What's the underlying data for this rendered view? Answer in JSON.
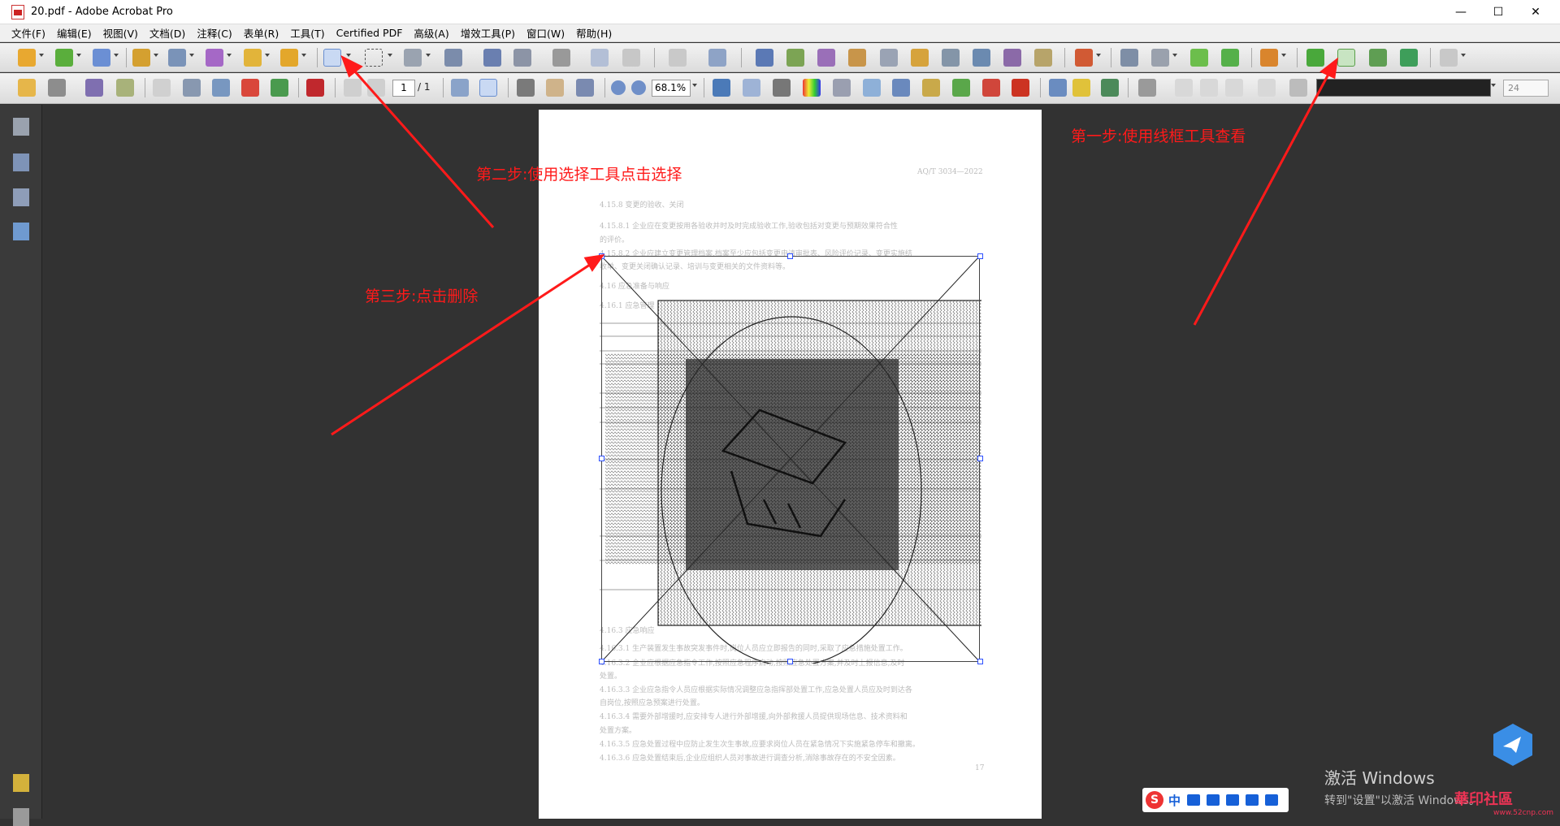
{
  "window": {
    "title": "20.pdf - Adobe Acrobat Pro",
    "minimize": "—",
    "maximize": "☐",
    "close": "✕"
  },
  "menu": [
    "文件(F)",
    "编辑(E)",
    "视图(V)",
    "文档(D)",
    "注释(C)",
    "表单(R)",
    "工具(T)",
    "Certified PDF",
    "高级(A)",
    "增效工具(P)",
    "窗口(W)",
    "帮助(H)"
  ],
  "toolbar2": {
    "page_current": "1",
    "page_total": "/ 1",
    "zoom": "68.1%",
    "font_size": "24"
  },
  "document": {
    "header_right": "AQ/T 3034—2022",
    "page_number": "17",
    "lines": [
      "4.15.8  变更的验收、关闭",
      "4.15.8.1  企业应在变更按用各验收并时及时完成验收工作,验收包括对变更与预期效果符合性",
      "的评价。",
      "4.15.8.2  企业应建立变更管理档案,档案至少应包括变更申请审批表、风险评价记录、变更实施结",
      "收单、变更关闭确认记录、培训与变更相关的文件资料等。",
      "4.16  应急准备与响应",
      "4.16.1  应急管理",
      "4.16.3  应急响应",
      "4.16.3.1  生产装置发生事故突发事件时,岗位人员应立即报告的同时,采取了应急措施处置工作。",
      "4.16.3.2  企业应根据应急指令工作,按照应急程序启动,按照应急处置方案,并及时上报信息,及时",
      "处置。",
      "4.16.3.3  企业应急指令人员应根据实际情况调整应急指挥部处置工作,应急处置人员应及时到达各",
      "自岗位,按照应急预案进行处置。",
      "4.16.3.4  需要外部增援时,应安排专人进行外部增援,向外部救援人员提供现场信息、技术资料和",
      "处置方案。",
      "4.16.3.5  应急处置过程中应防止发生次生事故,应要求岗位人员在紧急情况下实施紧急停车和撤离。",
      "4.16.3.6  应急处置结束后,企业应组织人员对事故进行调查分析,消除事故存在的不安全因素。"
    ]
  },
  "annotations": {
    "step1": "第一步:使用线框工具查看",
    "step2": "第二步:使用选择工具点击选择",
    "step3": "第三步:点击删除"
  },
  "activation": {
    "line1": "激活 Windows",
    "line2": "转到\"设置\"以激活 Windows。"
  },
  "ime": {
    "logo": "S",
    "mode": "中"
  },
  "watermark": {
    "text": "華印社區",
    "sub": "www.52cnp.com"
  },
  "colors": {
    "annotation": "#ff1a1a",
    "handle": "#2c4fff",
    "workspace": "#323232"
  }
}
